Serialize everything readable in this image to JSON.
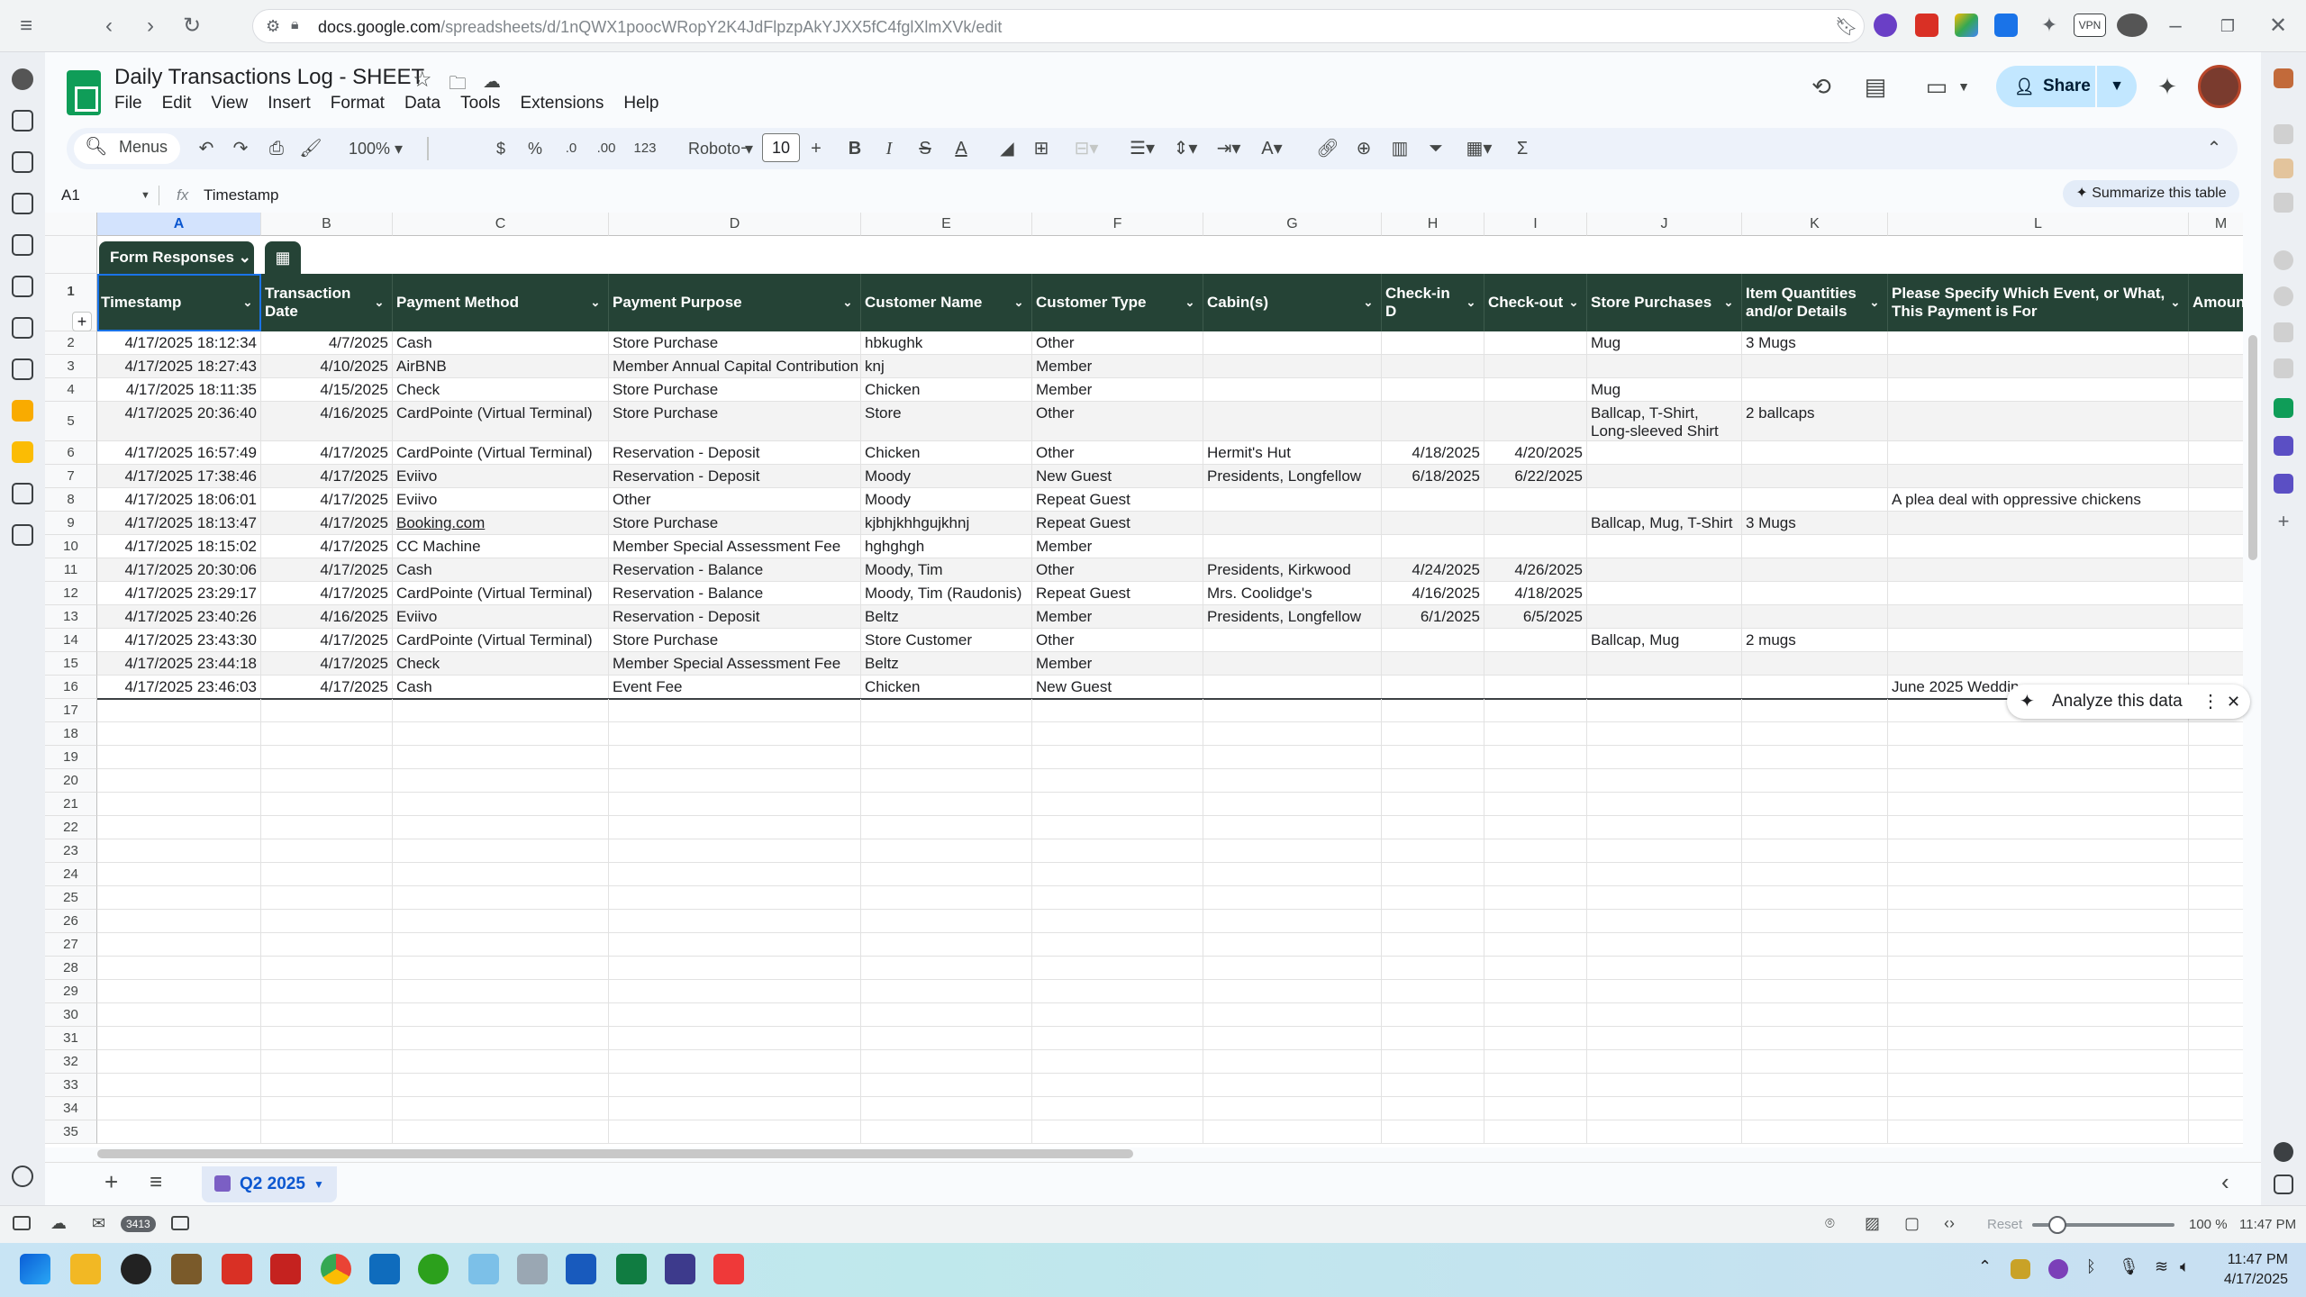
{
  "browser": {
    "url_host": "docs.google.com",
    "url_path": "/spreadsheets/d/1nQWX1poocWRopY2K4JdFlpzpAkYJXX5fC4fglXlmXVk/edit",
    "vpn_badge": "VPN"
  },
  "doc": {
    "title": "Daily Transactions Log - SHEET",
    "menu": [
      "File",
      "Edit",
      "View",
      "Insert",
      "Format",
      "Data",
      "Tools",
      "Extensions",
      "Help"
    ],
    "share_label": "Share"
  },
  "toolbar": {
    "menus_label": "Menus",
    "zoom": "100%",
    "currency": "$",
    "percent": "%",
    "dec_dec": ".0",
    "dec_inc": ".00",
    "number_format": "123",
    "font": "Roboto",
    "font_size": "10"
  },
  "formula_bar": {
    "name_box": "A1",
    "fx": "fx",
    "content": "Timestamp",
    "summarize": "Summarize this table"
  },
  "table": {
    "name": "Form Responses",
    "column_letters": [
      "A",
      "B",
      "C",
      "D",
      "E",
      "F",
      "G",
      "H",
      "I",
      "J",
      "K",
      "L",
      "M"
    ],
    "headers": [
      "Timestamp",
      "Transaction Date",
      "Payment Method",
      "Payment Purpose",
      "Customer Name",
      "Customer Type",
      "Cabin(s)",
      "Check-in D",
      "Check-out",
      "Store Purchases",
      "Item Quantities and/or Details",
      "Please Specify Which Event, or What, This Payment is For",
      "Amount"
    ],
    "rows": [
      [
        "4/17/2025 18:12:34",
        "4/7/2025",
        "Cash",
        "Store Purchase",
        "hbkughk",
        "Other",
        "",
        "",
        "",
        "Mug",
        "3 Mugs",
        "",
        ""
      ],
      [
        "4/17/2025 18:27:43",
        "4/10/2025",
        "AirBNB",
        "Member Annual Capital Contribution",
        "knj",
        "Member",
        "",
        "",
        "",
        "",
        "",
        "",
        ""
      ],
      [
        "4/17/2025 18:11:35",
        "4/15/2025",
        "Check",
        "Store Purchase",
        "Chicken",
        "Member",
        "",
        "",
        "",
        "Mug",
        "",
        "",
        ""
      ],
      [
        "4/17/2025 20:36:40",
        "4/16/2025",
        "CardPointe (Virtual Terminal)",
        "Store Purchase",
        "Store",
        "Other",
        "",
        "",
        "",
        "Ballcap, T-Shirt, Long-sleeved Shirt",
        "2 ballcaps",
        "",
        ""
      ],
      [
        "4/17/2025 16:57:49",
        "4/17/2025",
        "CardPointe (Virtual Terminal)",
        "Reservation - Deposit",
        "Chicken",
        "Other",
        "Hermit's Hut",
        "4/18/2025",
        "4/20/2025",
        "",
        "",
        "",
        ""
      ],
      [
        "4/17/2025 17:38:46",
        "4/17/2025",
        "Eviivo",
        "Reservation - Deposit",
        "Moody",
        "New Guest",
        "Presidents, Longfellow",
        "6/18/2025",
        "6/22/2025",
        "",
        "",
        "",
        ""
      ],
      [
        "4/17/2025 18:06:01",
        "4/17/2025",
        "Eviivo",
        "Other",
        "Moody",
        "Repeat Guest",
        "",
        "",
        "",
        "",
        "",
        "A plea deal with oppressive chickens",
        ""
      ],
      [
        "4/17/2025 18:13:47",
        "4/17/2025",
        "Booking.com",
        "Store Purchase",
        "kjbhjkhhgujkhnj",
        "Repeat Guest",
        "",
        "",
        "",
        "Ballcap, Mug, T-Shirt",
        "3 Mugs",
        "",
        ""
      ],
      [
        "4/17/2025 18:15:02",
        "4/17/2025",
        "CC Machine",
        "Member Special Assessment Fee",
        "hghghgh",
        "Member",
        "",
        "",
        "",
        "",
        "",
        "",
        ""
      ],
      [
        "4/17/2025 20:30:06",
        "4/17/2025",
        "Cash",
        "Reservation - Balance",
        "Moody, Tim",
        "Other",
        "Presidents, Kirkwood",
        "4/24/2025",
        "4/26/2025",
        "",
        "",
        "",
        ""
      ],
      [
        "4/17/2025 23:29:17",
        "4/17/2025",
        "CardPointe (Virtual Terminal)",
        "Reservation - Balance",
        "Moody, Tim (Raudonis)",
        "Repeat Guest",
        "Mrs. Coolidge's",
        "4/16/2025",
        "4/18/2025",
        "",
        "",
        "",
        ""
      ],
      [
        "4/17/2025 23:40:26",
        "4/16/2025",
        "Eviivo",
        "Reservation - Deposit",
        "Beltz",
        "Member",
        "Presidents, Longfellow",
        "6/1/2025",
        "6/5/2025",
        "",
        "",
        "",
        ""
      ],
      [
        "4/17/2025 23:43:30",
        "4/17/2025",
        "CardPointe (Virtual Terminal)",
        "Store Purchase",
        "Store Customer",
        "Other",
        "",
        "",
        "",
        "Ballcap, Mug",
        "2 mugs",
        "",
        ""
      ],
      [
        "4/17/2025 23:44:18",
        "4/17/2025",
        "Check",
        "Member Special Assessment Fee",
        "Beltz",
        "Member",
        "",
        "",
        "",
        "",
        "",
        "",
        ""
      ],
      [
        "4/17/2025 23:46:03",
        "4/17/2025",
        "Cash",
        "Event Fee",
        "Chicken",
        "New Guest",
        "",
        "",
        "",
        "",
        "",
        "June 2025 Weddin",
        ""
      ]
    ],
    "empty_row_numbers": [
      "17",
      "18",
      "19",
      "20",
      "21",
      "22",
      "23",
      "24",
      "25",
      "26",
      "27",
      "28",
      "29",
      "30",
      "31",
      "32",
      "33",
      "34",
      "35"
    ]
  },
  "analyze": {
    "label": "Analyze this data"
  },
  "sheet_tab": {
    "name": "Q2 2025"
  },
  "status": {
    "mail_count": "3413",
    "reset": "Reset",
    "zoom": "100 %",
    "time": "11:47 PM"
  },
  "taskbar": {
    "time": "11:47 PM",
    "date": "4/17/2025"
  }
}
